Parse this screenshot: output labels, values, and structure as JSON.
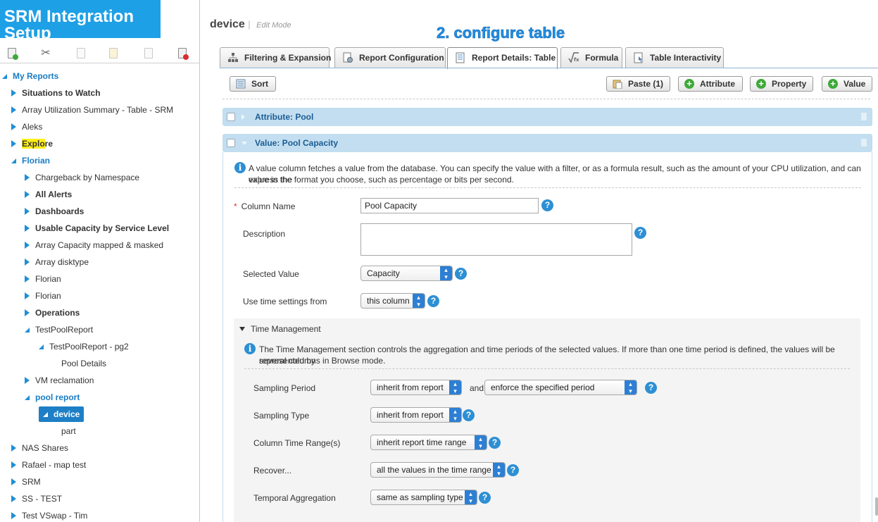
{
  "brand": {
    "title": "SRM Integration Setup"
  },
  "tree": {
    "items": [
      {
        "label": "My Reports"
      },
      {
        "label": "Situations to Watch"
      },
      {
        "label": "Array Utilization Summary - Table - SRM"
      },
      {
        "label": "Aleks"
      },
      {
        "label_hl": "Explo",
        "label_rest": "re"
      },
      {
        "label": "Florian"
      },
      {
        "label": "Chargeback by Namespace"
      },
      {
        "label": "All Alerts"
      },
      {
        "label": "Dashboards"
      },
      {
        "label": "Usable Capacity by Service Level"
      },
      {
        "label": "Array Capacity mapped & masked"
      },
      {
        "label": "Array disktype"
      },
      {
        "label": "Florian"
      },
      {
        "label": "Florian"
      },
      {
        "label": "Operations"
      },
      {
        "label": "TestPoolReport"
      },
      {
        "label": "TestPoolReport - pg2"
      },
      {
        "label": "Pool Details"
      },
      {
        "label": "VM reclamation"
      },
      {
        "label": "pool report"
      },
      {
        "label": "device"
      },
      {
        "label": "part"
      },
      {
        "label": "NAS Shares"
      },
      {
        "label": "Rafael - map test"
      },
      {
        "label": "SRM"
      },
      {
        "label": "SS - TEST"
      },
      {
        "label": "Test VSwap - Tim"
      }
    ]
  },
  "main": {
    "title": "device",
    "mode": "Edit Mode",
    "annotation": "2. configure table",
    "tabs": [
      {
        "label": "Filtering & Expansion"
      },
      {
        "label": "Report Configuration"
      },
      {
        "label": "Report Details: Table"
      },
      {
        "label": "Formula"
      },
      {
        "label": "Table Interactivity"
      }
    ],
    "buttons": {
      "sort": "Sort",
      "paste": "Paste (1)",
      "attribute": "Attribute",
      "property": "Property",
      "value": "Value"
    },
    "panels": {
      "attribute": "Attribute: Pool",
      "value": "Value: Pool Capacity"
    },
    "info_value_line1": "A value column fetches a value from the database. You can specify the value with a filter, or as a formula result, such as the amount of your CPU utilization, and can express the",
    "info_value_line2": "value in the format you choose, such as percentage or bits per second.",
    "form": {
      "column_name_label": "Column Name",
      "column_name_value": "Pool Capacity",
      "description_label": "Description",
      "selected_value_label": "Selected Value",
      "selected_value": "Capacity",
      "time_settings_label": "Use time settings from",
      "time_settings_value": "this column"
    },
    "time_mgmt": {
      "heading": "Time Management",
      "info_line1": "The Time Management section controls the aggregation and time periods of the selected values. If more than one time period is defined, the values will be represented by",
      "info_line2": "several columns in Browse mode.",
      "sampling_period_label": "Sampling Period",
      "sampling_period_value": "inherit from report",
      "and_label": "and",
      "enforce_value": "enforce the specified period",
      "sampling_type_label": "Sampling Type",
      "sampling_type_value": "inherit from report",
      "column_time_range_label": "Column Time Range(s)",
      "column_time_range_value": "inherit report time range",
      "recover_label": "Recover...",
      "recover_value": "all the values in the time range",
      "temporal_agg_label": "Temporal Aggregation",
      "temporal_agg_value": "same as sampling type"
    }
  }
}
